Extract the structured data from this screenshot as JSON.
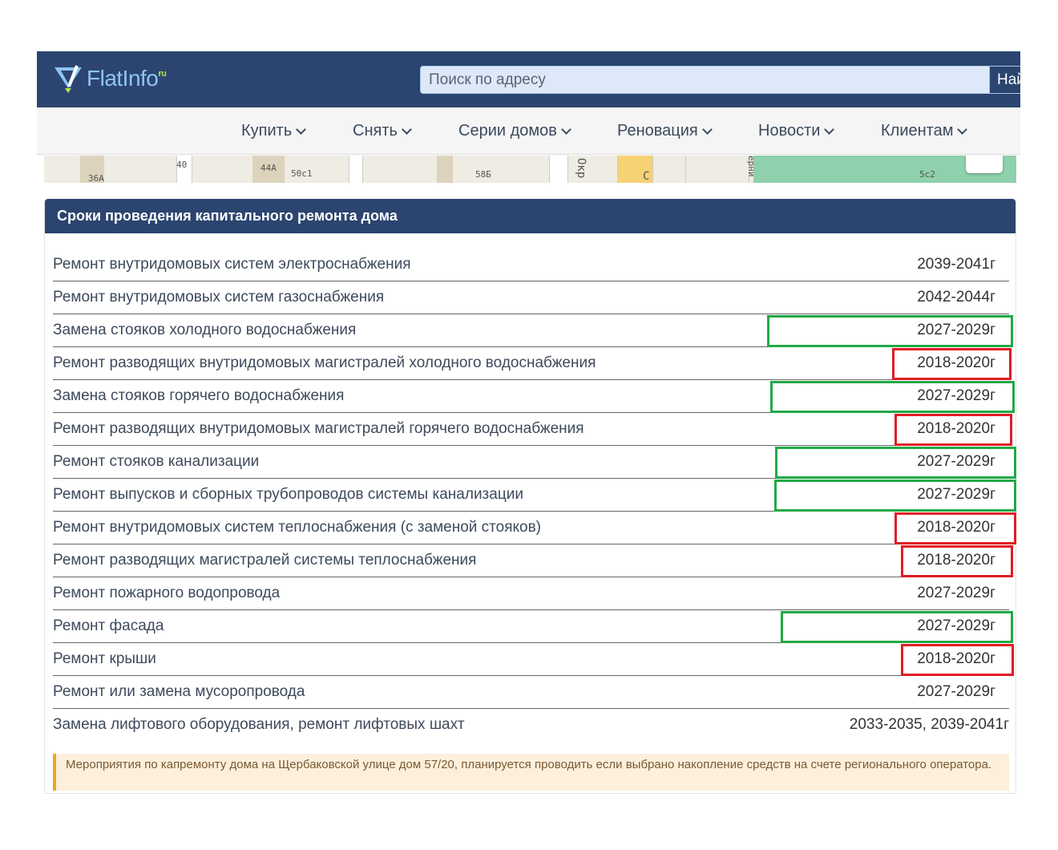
{
  "header": {
    "logo": "FlatInfo",
    "logo_suffix": "ru",
    "search_placeholder": "Поиск по адресу",
    "search_button": "Най"
  },
  "nav": [
    {
      "label": "Купить"
    },
    {
      "label": "Снять"
    },
    {
      "label": "Серии домов"
    },
    {
      "label": "Реновация"
    },
    {
      "label": "Новости"
    },
    {
      "label": "Клиентам"
    }
  ],
  "map": {
    "labels": [
      "36А",
      "40",
      "44А",
      "50с1",
      "58Б",
      "Окр",
      "С",
      "ерни",
      "5с2"
    ]
  },
  "section": {
    "title": "Сроки проведения капитального ремонта дома",
    "rows": [
      {
        "name": "Ремонт внутридомовых систем электроснабжения",
        "period": "2039-2041г",
        "highlight": null
      },
      {
        "name": "Ремонт внутридомовых систем газоснабжения",
        "period": "2042-2044г",
        "highlight": null
      },
      {
        "name": "Замена стояков холодного водоснабжения",
        "period": "2027-2029г",
        "highlight": "green"
      },
      {
        "name": "Ремонт разводящих внутридомовых магистралей холодного водоснабжения",
        "period": "2018-2020г",
        "highlight": "red"
      },
      {
        "name": "Замена стояков горячего водоснабжения",
        "period": "2027-2029г",
        "highlight": "green"
      },
      {
        "name": "Ремонт разводящих внутридомовых магистралей горячего водоснабжения",
        "period": "2018-2020г",
        "highlight": "red"
      },
      {
        "name": "Ремонт стояков канализации",
        "period": "2027-2029г",
        "highlight": "green"
      },
      {
        "name": "Ремонт выпусков и сборных трубопроводов системы канализации",
        "period": "2027-2029г",
        "highlight": "green"
      },
      {
        "name": "Ремонт внутридомовых систем теплоснабжения (с заменой стояков)",
        "period": "2018-2020г",
        "highlight": "red"
      },
      {
        "name": "Ремонт разводящих магистралей системы теплоснабжения",
        "period": "2018-2020г",
        "highlight": "red"
      },
      {
        "name": "Ремонт пожарного водопровода",
        "period": "2027-2029г",
        "highlight": null
      },
      {
        "name": "Ремонт фасада",
        "period": "2027-2029г",
        "highlight": "green"
      },
      {
        "name": "Ремонт крыши",
        "period": "2018-2020г",
        "highlight": "red"
      },
      {
        "name": "Ремонт или замена мусоропровода",
        "period": "2027-2029г",
        "highlight": null
      },
      {
        "name": "Замена лифтового оборудования, ремонт лифтовых шахт",
        "period": "2033-2035, 2039-2041г",
        "highlight": null
      }
    ],
    "note": "Мероприятия по капремонту дома на Щербаковской улице дом 57/20, планируется проводить если выбрано накопление средств на счете регионального оператора."
  },
  "colors": {
    "header": "#2b4570",
    "highlight_green": "#23a846",
    "highlight_red": "#e01d25",
    "note_bg": "#fcf0dc",
    "note_border": "#f0a229"
  }
}
